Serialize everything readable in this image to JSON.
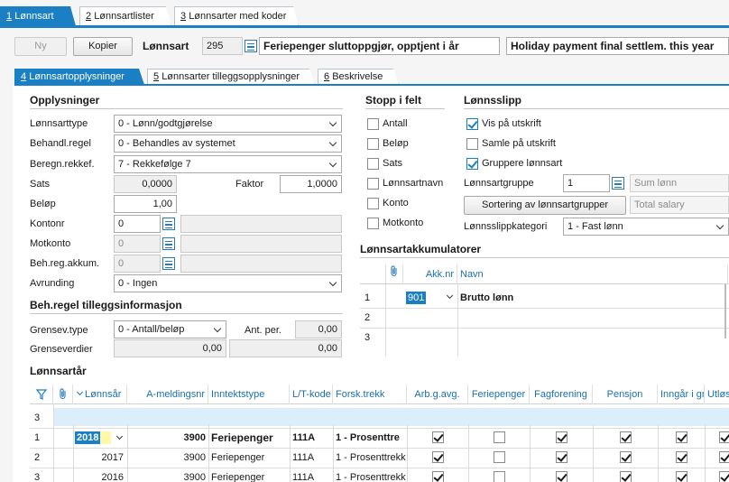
{
  "main_tabs": [
    {
      "key": "1",
      "label": "Lønnsart"
    },
    {
      "key": "2",
      "label": "Lønnsartlister"
    },
    {
      "key": "3",
      "label": "Lønnsarter med koder"
    }
  ],
  "toolbar": {
    "new_label": "Ny",
    "copy_label": "Kopier",
    "lonnsart_label": "Lønnsart",
    "lonnsart_number": "295",
    "name_no": "Feriepenger sluttoppgjør, opptjent i år",
    "name_en": "Holiday payment final settlem. this year"
  },
  "sub_tabs": [
    {
      "key": "4",
      "label": "Lønnsartopplysninger"
    },
    {
      "key": "5",
      "label": "Lønnsarter tilleggsopplysninger"
    },
    {
      "key": "6",
      "label": "Beskrivelse"
    }
  ],
  "opplysninger": {
    "title": "Opplysninger",
    "lonnsarttype_label": "Lønnsarttype",
    "lonnsarttype_value": "0 - Lønn/godtgjørelse",
    "behandl_label": "Behandl.regel",
    "behandl_value": "0 - Behandles av systemet",
    "beregn_label": "Beregn.rekkef.",
    "beregn_value": "7 - Rekkefølge 7",
    "sats_label": "Sats",
    "sats_value": "0,0000",
    "faktor_label": "Faktor",
    "faktor_value": "1,0000",
    "belop_label": "Beløp",
    "belop_value": "1,00",
    "kontonr_label": "Kontonr",
    "kontonr_value": "0",
    "motkonto_label": "Motkonto",
    "motkonto_value": "0",
    "behreg_label": "Beh.reg.akkum.",
    "behreg_value": "0",
    "avrunding_label": "Avrunding",
    "avrunding_value": "0 - Ingen"
  },
  "tillegg": {
    "title": "Beh.regel tilleggsinformasjon",
    "grensev_type_label": "Grensev.type",
    "grensev_type_value": "0 - Antall/beløp",
    "ant_per_label": "Ant. per.",
    "ant_per_value": "0,00",
    "grenseverdier_label": "Grenseverdier",
    "grense1": "0,00",
    "grense2": "0,00"
  },
  "stopp": {
    "title": "Stopp i felt",
    "items": [
      {
        "label": "Antall",
        "checked": false
      },
      {
        "label": "Beløp",
        "checked": false
      },
      {
        "label": "Sats",
        "checked": false
      },
      {
        "label": "Lønnsartnavn",
        "checked": false
      },
      {
        "label": "Konto",
        "checked": false
      },
      {
        "label": "Motkonto",
        "checked": false
      }
    ]
  },
  "lonnsslipp": {
    "title": "Lønnsslipp",
    "vis": {
      "label": "Vis på utskrift",
      "checked": true
    },
    "samle": {
      "label": "Samle på utskrift",
      "checked": false
    },
    "gruppere": {
      "label": "Gruppere lønnsart",
      "checked": true
    },
    "gruppe_label": "Lønnsartgruppe",
    "gruppe_value": "1",
    "gruppe_name": "Sum lønn",
    "sortering_label": "Sortering av lønnsartgrupper",
    "total_salary": "Total salary",
    "kategori_label": "Lønnsslippkategori",
    "kategori_value": "1 - Fast lønn"
  },
  "akkumulatorer": {
    "title": "Lønnsartakkumulatorer",
    "col_nr": "Akk.nr",
    "col_navn": "Navn",
    "rows": [
      {
        "idx": "1",
        "nr": "901",
        "navn": "Brutto lønn"
      },
      {
        "idx": "2",
        "nr": "",
        "navn": ""
      },
      {
        "idx": "3",
        "nr": "",
        "navn": ""
      }
    ]
  },
  "lonnsartar": {
    "title": "Lønnsartår",
    "headers": [
      "Lønnsår",
      "A-meldingsnr",
      "Inntektstype",
      "L/T-kode",
      "Forsk.trekk",
      "Arb.g.avg.",
      "Feriepenger",
      "Fagforening",
      "Pensjon",
      "Inngår i gr",
      "Utløs"
    ],
    "filter_row_idx": "3",
    "rows": [
      {
        "idx": "1",
        "year": "2018",
        "amelding": "3900",
        "inntekt": "Feriepenger",
        "lt": "111A",
        "forsk": "1 - Prosenttre",
        "arbg": true,
        "ferie": false,
        "fag": true,
        "pensjon": true,
        "inngar": true,
        "utlos": true
      },
      {
        "idx": "2",
        "year": "2017",
        "amelding": "3900",
        "inntekt": "Feriepenger",
        "lt": "111A",
        "forsk": "1 - Prosenttrekk",
        "arbg": true,
        "ferie": false,
        "fag": true,
        "pensjon": true,
        "inngar": true,
        "utlos": true
      },
      {
        "idx": "3",
        "year": "2016",
        "amelding": "3900",
        "inntekt": "Feriepenger",
        "lt": "111A",
        "forsk": "1 - Prosenttrekk",
        "arbg": true,
        "ferie": false,
        "fag": true,
        "pensjon": true,
        "inngar": true,
        "utlos": true
      }
    ]
  }
}
